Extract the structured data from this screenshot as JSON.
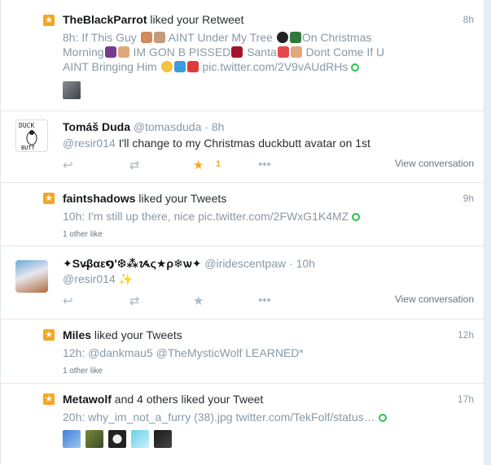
{
  "notifications": [
    {
      "type": "like",
      "user": "TheBlackParrot",
      "action": "liked your Retweet",
      "time": "8h",
      "tweet_line1": "8h: If This Guy",
      "tweet_mid1": "AINT Under My Tree",
      "tweet_end1": "On Christmas",
      "tweet_line2a": "Morning",
      "tweet_line2b": "IM GON B PISSED",
      "tweet_line2c": "Santa",
      "tweet_line2d": "Dont Come If U",
      "tweet_line3": "AINT Bringing Him",
      "link": "pic.twitter.com/2V9vAUdRHs"
    },
    {
      "type": "tweet",
      "user": "Tomáš Duda",
      "handle": "@tomasduda",
      "dot": "·",
      "time": "8h",
      "mention": "@resir014",
      "text": "I'll change to my Christmas duckbutt avatar on 1st",
      "fav_count": "1",
      "view_conversation": "View conversation"
    },
    {
      "type": "like",
      "user": "faintshadows",
      "action": "liked your Tweets",
      "time": "9h",
      "tweet": "10h: I'm still up there, nice",
      "link": "pic.twitter.com/2FWxG1K4MZ",
      "other_like": "1 other like"
    },
    {
      "type": "tweet",
      "user": "✦Sv̶βαε໑'❆⁂ᝰς★ρ❄ѡ✦",
      "handle": "@iridescentpaw",
      "dot": "·",
      "time": "10h",
      "mention": "@resir014",
      "text": "✨",
      "view_conversation": "View conversation"
    },
    {
      "type": "like",
      "user": "Miles",
      "action": "liked your Tweets",
      "time": "12h",
      "tweet": "12h:",
      "mention1": "@dankmau5",
      "mention2": "@TheMysticWolf",
      "tweet_end": "LEARNED*",
      "other_like": "1 other like"
    },
    {
      "type": "like",
      "user": "Metawolf",
      "action": "and 4 others liked your Tweet",
      "time": "17h",
      "tweet": "20h: why_im_not_a_furry (38).jpg",
      "link": "twitter.com/TekFolf/status…"
    }
  ],
  "icons": {
    "star": "star-icon",
    "reply": "reply-icon",
    "retweet": "retweet-icon",
    "like": "like-icon",
    "more": "more-icon"
  },
  "colors": {
    "like_star": "#f5a623",
    "link_ring": "#2fbf4f",
    "muted": "#8899a6"
  }
}
